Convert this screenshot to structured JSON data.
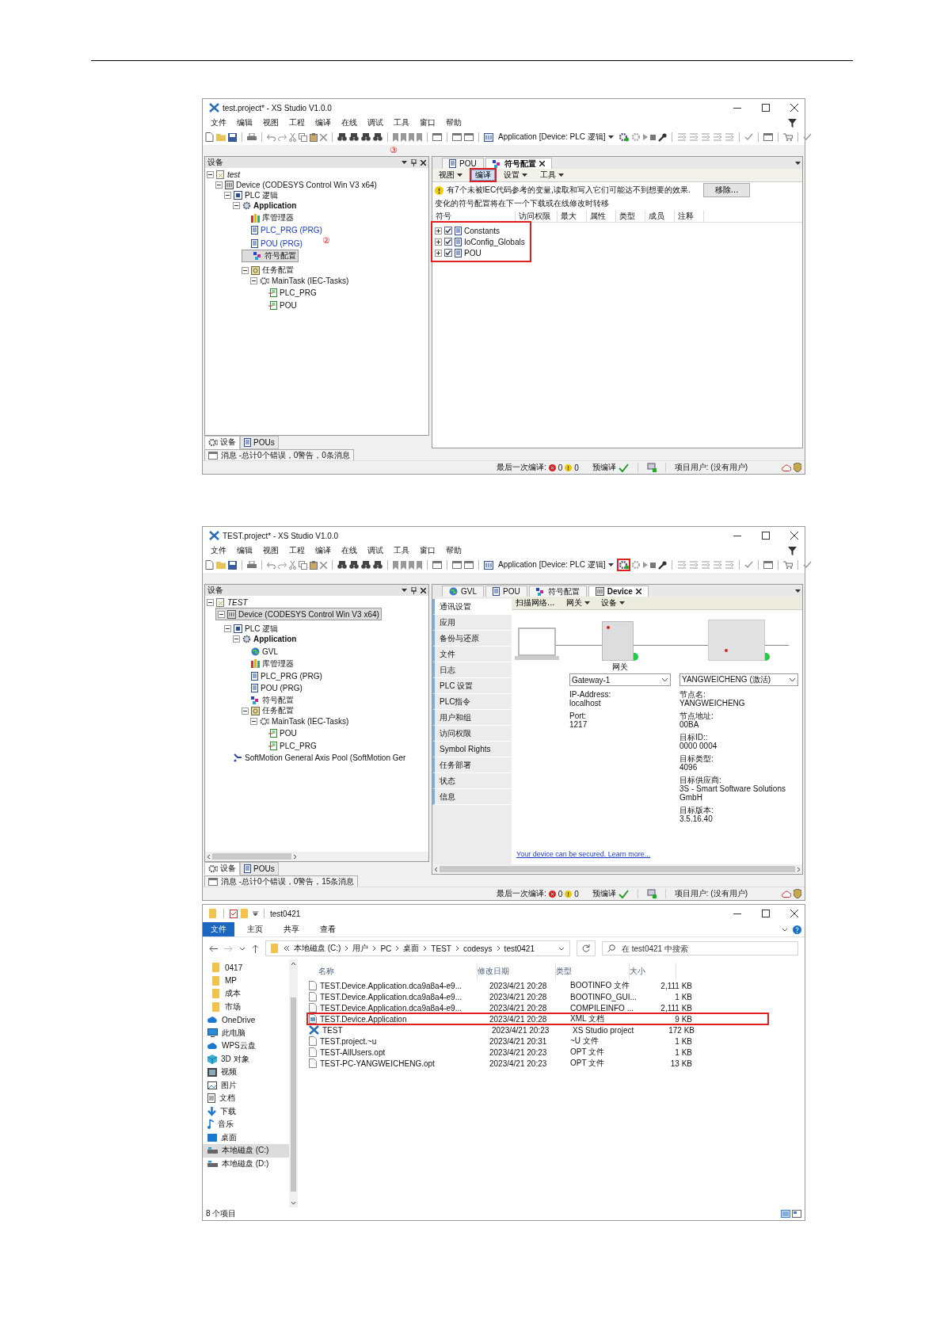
{
  "screenshots": [
    {
      "kind": "ide",
      "title": "test.project* - XS Studio V1.0.0",
      "menu": [
        "文件",
        "编辑",
        "视图",
        "工程",
        "编译",
        "在线",
        "调试",
        "工具",
        "窗口",
        "帮助"
      ],
      "toolbar": {
        "app_selector": "Application [Device: PLC 逻辑]",
        "login_highlighted": false
      },
      "annotation": "③",
      "devices_panel": {
        "title": "设备",
        "tree": [
          {
            "label": "test",
            "kind": "project",
            "selected": false,
            "expanded": true,
            "children": [
              {
                "label": "Device (CODESYS Control Win V3 x64)",
                "kind": "device",
                "selected": false,
                "expanded": true,
                "children": [
                  {
                    "label": "PLC 逻辑",
                    "kind": "plc",
                    "selected": false,
                    "expanded": true,
                    "children": [
                      {
                        "label": "Application",
                        "kind": "application",
                        "selected": false,
                        "expanded": true,
                        "children": [
                          {
                            "label": "库管理器",
                            "kind": "library",
                            "selected": false
                          },
                          {
                            "label": "PLC_PRG (PRG)",
                            "kind": "pou",
                            "selected": false,
                            "color": "#1a3ad0"
                          },
                          {
                            "label": "POU (PRG)",
                            "kind": "pou",
                            "selected": false,
                            "color": "#1a3ad0",
                            "annotation": "②"
                          },
                          {
                            "label": "符号配置",
                            "kind": "symbols",
                            "selected": true
                          },
                          {
                            "label": "任务配置",
                            "kind": "tasks",
                            "selected": false,
                            "expanded": true,
                            "children": [
                              {
                                "label": "MainTask (IEC-Tasks)",
                                "kind": "task",
                                "selected": false,
                                "expanded": true,
                                "children": [
                                  {
                                    "label": "PLC_PRG",
                                    "kind": "call",
                                    "selected": false
                                  },
                                  {
                                    "label": "POU",
                                    "kind": "call",
                                    "selected": false
                                  }
                                ]
                              }
                            ]
                          }
                        ]
                      }
                    ]
                  }
                ]
              }
            ]
          }
        ]
      },
      "bottom_tabs": [
        {
          "label": "设备",
          "selected": true
        },
        {
          "label": "POUs",
          "selected": false
        }
      ],
      "editor_tabs": [
        {
          "label": "POU",
          "kind": "pou",
          "selected": false
        },
        {
          "label": "符号配置",
          "kind": "symbols",
          "selected": true
        }
      ],
      "editor": {
        "kind": "symbols",
        "toolbar": [
          {
            "label": "视图",
            "dropdown": true,
            "highlighted": false
          },
          {
            "label": "编译",
            "dropdown": false,
            "highlighted": true
          },
          {
            "label": "设置",
            "dropdown": true,
            "highlighted": false
          },
          {
            "label": "工具",
            "dropdown": true,
            "highlighted": false
          }
        ],
        "warning": "有7个未被IEC代码参考的变量,读取和写入它们可能达不到想要的效果.",
        "remove_button": "移除...",
        "info": "变化的符号配置将在下一个下载或在线修改时转移",
        "columns": [
          "符号",
          "访问权限",
          "最大",
          "属性",
          "类型",
          "成员",
          "注释"
        ],
        "rows_highlighted": true,
        "rows": [
          {
            "name": "Constants",
            "checked": true,
            "expanded": false
          },
          {
            "name": "IoConfig_Globals",
            "checked": true,
            "expanded": false
          },
          {
            "name": "POU",
            "checked": true,
            "expanded": false
          }
        ]
      },
      "messages": "消息 -总计0个错误，0警告，0条消息",
      "status_bar": {
        "last_build": "最后一次编译:",
        "errors": "0",
        "warnings": "0",
        "precompile": "预编译",
        "user": "项目用户: (没有用户)"
      }
    },
    {
      "kind": "ide",
      "title": "TEST.project* - XS Studio V1.0.0",
      "menu": [
        "文件",
        "编辑",
        "视图",
        "工程",
        "编译",
        "在线",
        "调试",
        "工具",
        "窗口",
        "帮助"
      ],
      "toolbar": {
        "app_selector": "Application [Device: PLC 逻辑]",
        "login_highlighted": true
      },
      "devices_panel": {
        "title": "设备",
        "horizontal_scrollbar": true,
        "tree": [
          {
            "label": "TEST",
            "kind": "project",
            "selected": false,
            "expanded": true,
            "children": [
              {
                "label": "Device (CODESYS Control Win V3 x64)",
                "kind": "device",
                "selected": true,
                "expanded": true,
                "children": [
                  {
                    "label": "PLC 逻辑",
                    "kind": "plc",
                    "selected": false,
                    "expanded": true,
                    "children": [
                      {
                        "label": "Application",
                        "kind": "application",
                        "selected": false,
                        "expanded": true,
                        "children": [
                          {
                            "label": "GVL",
                            "kind": "gvl",
                            "selected": false
                          },
                          {
                            "label": "库管理器",
                            "kind": "library",
                            "selected": false
                          },
                          {
                            "label": "PLC_PRG (PRG)",
                            "kind": "pou",
                            "selected": false
                          },
                          {
                            "label": "POU (PRG)",
                            "kind": "pou",
                            "selected": false
                          },
                          {
                            "label": "符号配置",
                            "kind": "symbols",
                            "selected": false
                          },
                          {
                            "label": "任务配置",
                            "kind": "tasks",
                            "selected": false,
                            "expanded": true,
                            "children": [
                              {
                                "label": "MainTask (IEC-Tasks)",
                                "kind": "task",
                                "selected": false,
                                "expanded": true,
                                "children": [
                                  {
                                    "label": "POU",
                                    "kind": "call",
                                    "selected": false
                                  },
                                  {
                                    "label": "PLC_PRG",
                                    "kind": "call",
                                    "selected": false
                                  }
                                ]
                              }
                            ]
                          }
                        ]
                      }
                    ]
                  },
                  {
                    "label": "SoftMotion General Axis Pool (SoftMotion Ger",
                    "kind": "axis",
                    "selected": false
                  }
                ]
              }
            ]
          }
        ]
      },
      "bottom_tabs": [
        {
          "label": "设备",
          "selected": true
        },
        {
          "label": "POUs",
          "selected": false
        }
      ],
      "editor_tabs": [
        {
          "label": "GVL",
          "kind": "gvl",
          "selected": false
        },
        {
          "label": "POU",
          "kind": "pou",
          "selected": false
        },
        {
          "label": "符号配置",
          "kind": "symbols",
          "selected": false
        },
        {
          "label": "Device",
          "kind": "device",
          "selected": true
        }
      ],
      "editor": {
        "kind": "device",
        "nav": [
          {
            "label": "通讯设置",
            "selected": true
          },
          {
            "label": "应用",
            "selected": false
          },
          {
            "label": "备份与还原",
            "selected": false
          },
          {
            "label": "文件",
            "selected": false
          },
          {
            "label": "日志",
            "selected": false
          },
          {
            "label": "PLC 设置",
            "selected": false
          },
          {
            "label": "PLC指令",
            "selected": false
          },
          {
            "label": "用户和组",
            "selected": false
          },
          {
            "label": "访问权限",
            "selected": false
          },
          {
            "label": "Symbol Rights",
            "selected": false
          },
          {
            "label": "任务部署",
            "selected": false
          },
          {
            "label": "状态",
            "selected": false
          },
          {
            "label": "信息",
            "selected": false
          }
        ],
        "toolbar": [
          {
            "label": "扫描网络...",
            "dropdown": false,
            "highlighted": false
          },
          {
            "label": "网关",
            "dropdown": true,
            "highlighted": false
          },
          {
            "label": "设备",
            "dropdown": true,
            "highlighted": false
          }
        ],
        "gateway": {
          "label": "网关",
          "online": true,
          "select": "Gateway-1",
          "fields": [
            {
              "label": "IP-Address:",
              "value": "localhost"
            },
            {
              "label": "Port:",
              "value": "1217"
            }
          ]
        },
        "device": {
          "online": true,
          "select": "YANGWEICHENG (激活)",
          "fields": [
            {
              "label": "节点名:",
              "value": "YANGWEICHENG"
            },
            {
              "label": "节点地址:",
              "value": "00BA"
            },
            {
              "label": "目标ID::",
              "value": "0000  0004"
            },
            {
              "label": "目标类型:",
              "value": "4096"
            },
            {
              "label": "目标供应商:",
              "value": "3S - Smart Software Solutions GmbH"
            },
            {
              "label": "目标版本:",
              "value": "3.5.16.40"
            }
          ]
        },
        "link": "Your device can be secured. Learn more..."
      },
      "messages": "消息 -总计0个错误，0警告，15条消息",
      "status_bar": {
        "last_build": "最后一次编译:",
        "errors": "0",
        "warnings": "0",
        "precompile": "预编译",
        "user": "项目用户: (没有用户)"
      }
    },
    {
      "kind": "explorer",
      "title": "test0421",
      "ribbon_tabs": [
        {
          "label": "文件",
          "selected": true
        },
        {
          "label": "主页",
          "selected": false
        },
        {
          "label": "共享",
          "selected": false
        },
        {
          "label": "查看",
          "selected": false
        }
      ],
      "address": [
        "本地磁盘 (C:)",
        "用户",
        "PC",
        "桌面",
        "TEST",
        "codesys",
        "test0421"
      ],
      "search": {
        "placeholder": "在 test0421 中搜索"
      },
      "nav": [
        {
          "label": "0417",
          "kind": "folder",
          "selected": false
        },
        {
          "label": "MP",
          "kind": "folder",
          "selected": false
        },
        {
          "label": "成本",
          "kind": "folder",
          "selected": false
        },
        {
          "label": "市场",
          "kind": "folder",
          "selected": false
        },
        {
          "label": "OneDrive",
          "kind": "cloud",
          "selected": false
        },
        {
          "label": "此电脑",
          "kind": "pc",
          "selected": false
        },
        {
          "label": "WPS云盘",
          "kind": "cloud",
          "selected": false
        },
        {
          "label": "3D 对象",
          "kind": "cube",
          "selected": false
        },
        {
          "label": "视频",
          "kind": "video",
          "selected": false
        },
        {
          "label": "图片",
          "kind": "picture",
          "selected": false
        },
        {
          "label": "文档",
          "kind": "document",
          "selected": false
        },
        {
          "label": "下载",
          "kind": "download",
          "selected": false
        },
        {
          "label": "音乐",
          "kind": "music",
          "selected": false
        },
        {
          "label": "桌面",
          "kind": "desktop",
          "selected": false
        },
        {
          "label": "本地磁盘 (C:)",
          "kind": "drive",
          "selected": true
        },
        {
          "label": "本地磁盘 (D:)",
          "kind": "drive",
          "selected": false
        }
      ],
      "columns": [
        "名称",
        "修改日期",
        "类型",
        "大小"
      ],
      "files": [
        {
          "name": "TEST.Device.Application.dca9a8a4-e9...",
          "date": "2023/4/21 20:28",
          "type": "BOOTINFO 文件",
          "size": "2,111 KB",
          "kind": "file",
          "highlighted": false
        },
        {
          "name": "TEST.Device.Application.dca9a8a4-e9...",
          "date": "2023/4/21 20:28",
          "type": "BOOTINFO_GUI...",
          "size": "1 KB",
          "kind": "file",
          "highlighted": false
        },
        {
          "name": "TEST.Device.Application.dca9a8a4-e9...",
          "date": "2023/4/21 20:28",
          "type": "COMPILEINFO ...",
          "size": "2,111 KB",
          "kind": "file",
          "highlighted": false
        },
        {
          "name": "TEST.Device.Application",
          "date": "2023/4/21 20:28",
          "type": "XML 文档",
          "size": "9 KB",
          "kind": "xml",
          "highlighted": true
        },
        {
          "name": "TEST",
          "date": "2023/4/21 20:23",
          "type": "XS Studio project",
          "size": "172 KB",
          "kind": "project",
          "highlighted": false
        },
        {
          "name": "TEST.project.~u",
          "date": "2023/4/21 20:31",
          "type": "~U 文件",
          "size": "1 KB",
          "kind": "file",
          "highlighted": false
        },
        {
          "name": "TEST-AllUsers.opt",
          "date": "2023/4/21 20:23",
          "type": "OPT 文件",
          "size": "1 KB",
          "kind": "file",
          "highlighted": false
        },
        {
          "name": "TEST-PC-YANGWEICHENG.opt",
          "date": "2023/4/21 20:23",
          "type": "OPT 文件",
          "size": "13 KB",
          "kind": "file",
          "highlighted": false
        }
      ],
      "status": "8 个项目"
    }
  ]
}
